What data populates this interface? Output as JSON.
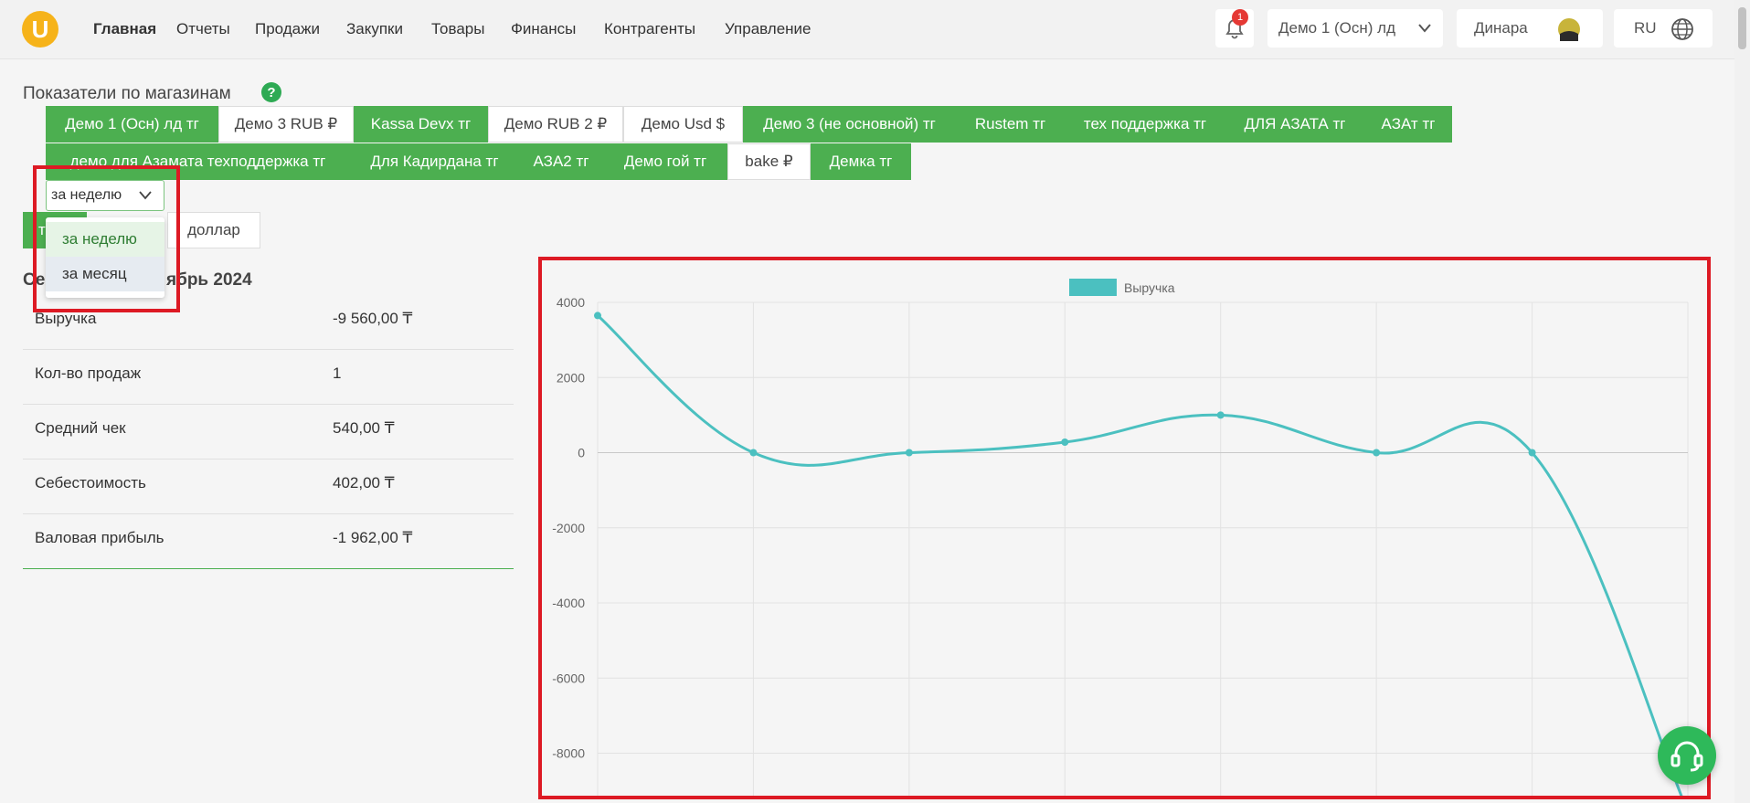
{
  "nav": {
    "items": [
      "Главная",
      "Отчеты",
      "Продажи",
      "Закупки",
      "Товары",
      "Финансы",
      "Контрагенты",
      "Управление"
    ],
    "notifications_count": "1",
    "store_select": "Демо 1 (Осн) лд",
    "user_name": "Динара",
    "language": "RU"
  },
  "section_title": "Показатели по магазинам",
  "store_tabs_row1": [
    "Демо 1 (Осн) лд тг",
    "Демо 3 RUB ₽",
    "Kassa Devx тг",
    "Демо RUB 2 ₽",
    "Демо Usd $",
    "Демо 3 (не основной) тг",
    "Rustem тг",
    "тех поддержка тг",
    "ДЛЯ АЗАТА тг",
    "АЗАт тг"
  ],
  "store_tabs_row2": [
    "демо для Азамата техподдержка тг",
    "Для Кадирдана тг",
    "АЗА2 тг",
    "Демо гой тг",
    "bake ₽",
    "Демка тг"
  ],
  "period_select": {
    "value": "за неделю",
    "options": [
      "за неделю",
      "за месяц"
    ]
  },
  "currency_buttons": [
    "т",
    "доллар"
  ],
  "period_title_visible": [
    "Се",
    "ябрь 2024"
  ],
  "stats": [
    {
      "label": "Выручка",
      "value": "-9 560,00 ₸"
    },
    {
      "label": "Кол-во продаж",
      "value": "1"
    },
    {
      "label": "Средний чек",
      "value": "540,00 ₸"
    },
    {
      "label": "Себестоимость",
      "value": "402,00 ₸"
    },
    {
      "label": "Валовая прибыль",
      "value": "-1 962,00 ₸"
    }
  ],
  "colors": {
    "green": "#4caf50",
    "series": "#4bc0c0",
    "highlight": "#dd1a24"
  },
  "chart_data": {
    "type": "line",
    "series": [
      {
        "name": "Выручка",
        "values": [
          3650,
          0,
          0,
          280,
          1000,
          0,
          0,
          -9560
        ]
      }
    ],
    "ylim": [
      -9600,
      4000
    ],
    "yticks": [
      4000,
      2000,
      0,
      -2000,
      -4000,
      -6000,
      -8000
    ],
    "grid": true,
    "legend": "top"
  }
}
